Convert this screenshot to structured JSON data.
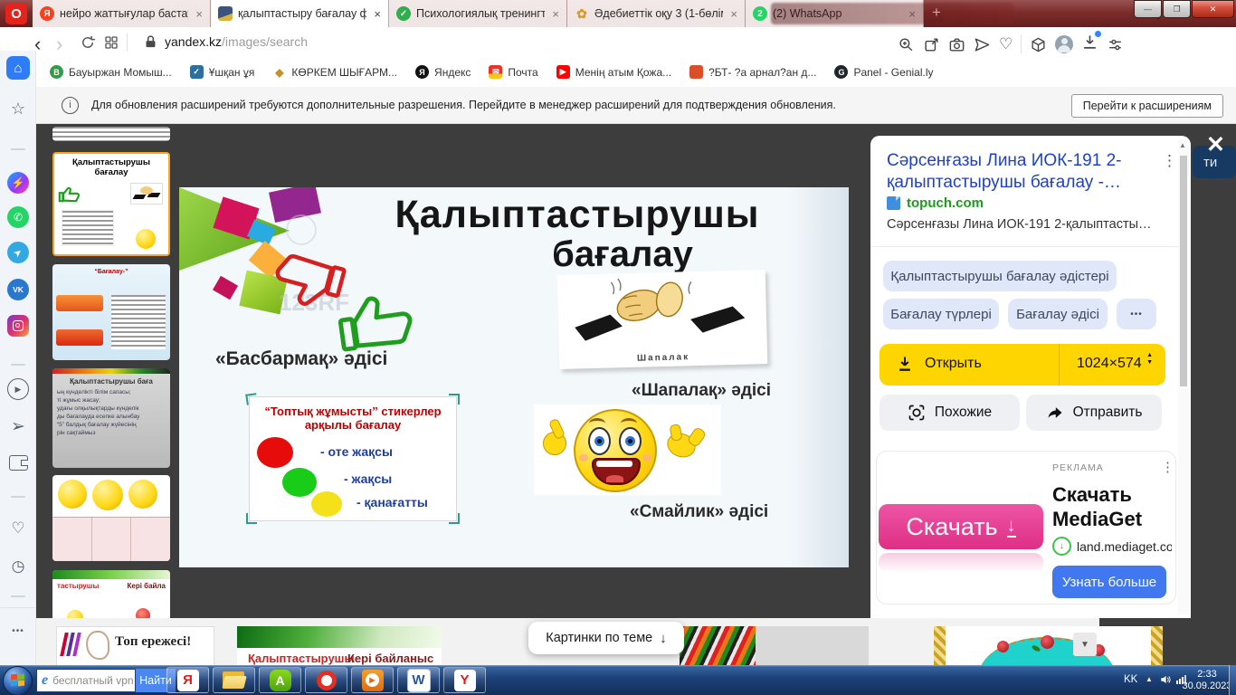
{
  "glyphs": {
    "close_tab": "×",
    "new_tab": "+",
    "back": "‹",
    "forward": "›",
    "heart": "♡",
    "dots_v": "⋮",
    "dots_h": "•••",
    "home": "⌂",
    "star": "☆",
    "down_arrow": "↓",
    "up_tri": "▲",
    "down_tri": "▼",
    "win_min": "—",
    "win_restore": "❐",
    "win_close": "✕",
    "check": "✓",
    "ya": "Я",
    "b": "B",
    "g": "G",
    "o": "O",
    "w": "W",
    "y": "Y",
    "a": "A",
    "e": "e",
    "envelope": "✉",
    "play": "▶",
    "flower": "✿",
    "vk": "VK",
    "two": "2",
    "clock": "◷",
    "close_x": "✕",
    "msgr": "⚡",
    "phone": "✆",
    "send": "➢"
  },
  "tab_bar": {
    "tabs": [
      {
        "label": "нейро жаттығулар бастауы"
      },
      {
        "label": "қалыптастыру бағалау фот"
      },
      {
        "label": "Психологиялық тренингте"
      },
      {
        "label": "Әдебиеттік оқу 3 (1-бөлім"
      },
      {
        "label": "(2) WhatsApp"
      }
    ]
  },
  "toolbar": {
    "url_domain": "yandex.kz",
    "url_path": "/images/search"
  },
  "bookmarks": [
    {
      "label": "Бауыржан Момыш..."
    },
    {
      "label": "Ұшқан ұя"
    },
    {
      "label": "КӨРКЕМ ШЫҒАРМ..."
    },
    {
      "label": "Яндекс"
    },
    {
      "label": "Почта"
    },
    {
      "label": "Менің атым Қожа..."
    },
    {
      "label": "?БТ- ?а арнал?ан д..."
    },
    {
      "label": "Panel - Genial.ly"
    }
  ],
  "notification": {
    "text": "Для обновления расширений требуются дополнительные разрешения. Перейдите в менеджер расширений для подтверждения обновления.",
    "button": "Перейти к расширениям"
  },
  "slide": {
    "title_line1": "Қалыптастырушы",
    "title_line2": "бағалау",
    "watermark": "123RF",
    "basbarmak": "«Басбармақ» әдісі",
    "clap_caption": "Шапалак",
    "shapalak": "«Шапалақ» әдісі",
    "smailik": "«Смайлик» әдісі",
    "card_title1": "“Топтық жұмысты” стикерлер",
    "card_title2": "арқылы бағалау",
    "rating_good": "- оте жақсы",
    "rating_ok": "- жақсы",
    "rating_sat": "- қанағатты"
  },
  "thumbs": {
    "selected_title1": "Қалыптастырушы",
    "selected_title2": "бағалау",
    "t2_heading": "“Бағалау-”",
    "t3_title": "Қалыптастырушы баға",
    "t3_lines": [
      "ың күнделікті білім сапасы;",
      "ті жұмыс жасау;",
      "удағы олқылықтарды күнделік",
      "ды бағалауда есепке алынбау",
      "“5” балдық бағалау жүйесінің",
      "рін сақтаймыз"
    ],
    "t5_red": "тастырушы",
    "t5_dark": "Кері байла"
  },
  "viewer": {
    "title": "Сәрсенғазы Лина ИОК-191 2-қалыптастырушы бағалау -…",
    "source": "topuch.com",
    "description": "Сәрсенғазы Лина ИОК-191 2-қалыптасты…",
    "tags": [
      {
        "label": "Қалыптастырушы бағалау әдістері"
      },
      {
        "label": "Бағалау түрлері"
      },
      {
        "label": "Бағалау әдісі"
      }
    ],
    "open_label": "Открыть",
    "size_label": "1024×574",
    "similar_label": "Похожие",
    "send_label": "Отправить",
    "ad": {
      "badge": "РЕКЛАМА",
      "pink_button": "Скачать",
      "title1": "Скачать",
      "title2": "MediaGet",
      "url": "land.mediaget.co",
      "cta": "Узнать больше"
    },
    "related_button": "Картинки по теме",
    "behind_text": "ти"
  },
  "bottom_row": {
    "thumb_a": "Топ ережесі!",
    "thumb_b1": "Қалыптастырушы",
    "thumb_b2": "Кері байланыс"
  },
  "taskbar": {
    "search_text": "бесплатный vpn",
    "search_button": "Найти",
    "lang": "KK",
    "time": "2:33",
    "date": "30.09.2023"
  }
}
